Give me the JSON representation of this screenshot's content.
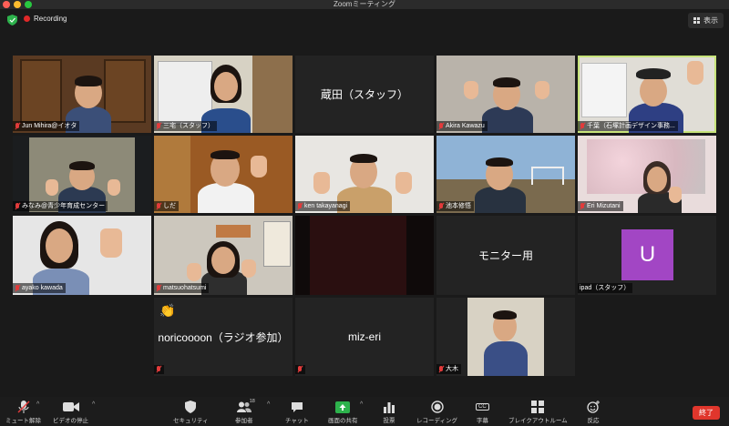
{
  "window": {
    "title": "Zoomミーティング"
  },
  "topbar": {
    "recording_label": "Recording",
    "view_label": "表示"
  },
  "participants": [
    {
      "name": "Jun Mihira@イオタ",
      "muted": true
    },
    {
      "name": "三宅（スタッフ）",
      "muted": true
    },
    {
      "name": "蔵田（スタッフ）",
      "muted": false,
      "video": false
    },
    {
      "name": "Akira Kawazu",
      "muted": true
    },
    {
      "name": "千葉（石塚計画デザイン事務...",
      "muted": true,
      "active_speaker": true
    },
    {
      "name": "みなみ@青少年育成センター",
      "muted": true
    },
    {
      "name": "しだ",
      "muted": true
    },
    {
      "name": "ken takayanagi",
      "muted": true
    },
    {
      "name": "池本修悟",
      "muted": true
    },
    {
      "name": "Eri Mizutani",
      "muted": true
    },
    {
      "name": "ayako kawada",
      "muted": true
    },
    {
      "name": "matsuohatsumi",
      "muted": true
    },
    {
      "name": "",
      "muted": false,
      "video": "dark"
    },
    {
      "name": "モニター用",
      "muted": false,
      "video": false
    },
    {
      "name": "ipad（スタッフ）",
      "muted": false,
      "avatar_letter": "U",
      "avatar_color": "#a246c4"
    },
    {
      "name": "noricoooon（ラジオ参加）",
      "muted": true,
      "video": false,
      "reaction": "clap"
    },
    {
      "name": "miz-eri",
      "muted": true,
      "video": false
    },
    {
      "name": "大木",
      "muted": true
    }
  ],
  "toolbar": {
    "mute_label": "ミュート解除",
    "video_label": "ビデオの停止",
    "security_label": "セキュリティ",
    "participants_label": "参加者",
    "participants_count": "18",
    "chat_label": "チャット",
    "share_label": "画面の共有",
    "polls_label": "投票",
    "record_label": "レコーディング",
    "captions_label": "字幕",
    "captions_icon_text": "CC",
    "breakout_label": "ブレイクアウトルーム",
    "reactions_label": "反応",
    "end_label": "終了"
  },
  "colors": {
    "accent_green": "#c7e37a",
    "end_red": "#e0362c",
    "share_green": "#2db24c",
    "record_red": "#e02828"
  }
}
